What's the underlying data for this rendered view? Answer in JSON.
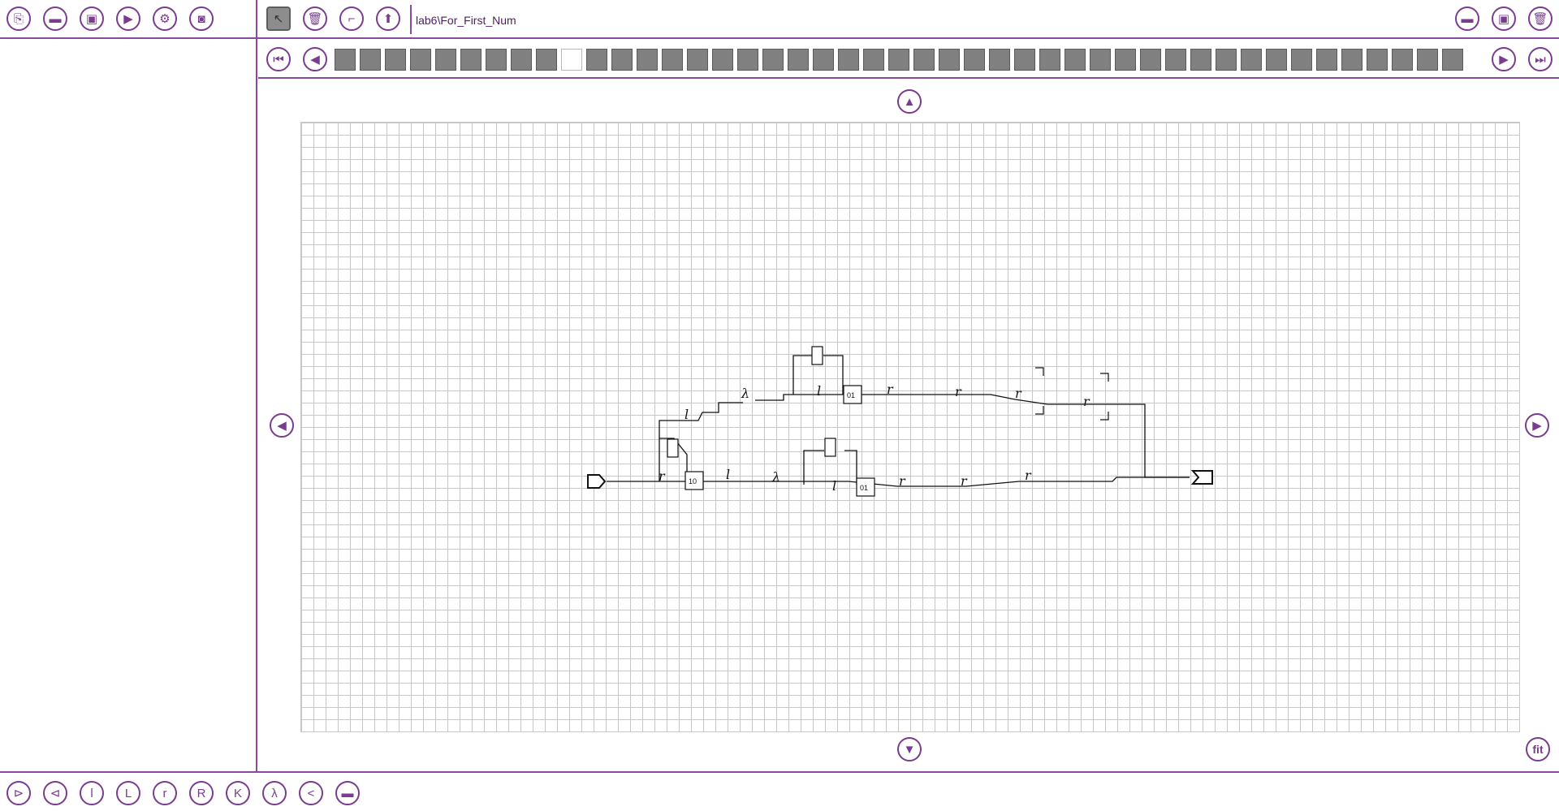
{
  "window_title": "lab6\\For_First_Num",
  "toolbar_left": [
    {
      "name": "new-file-icon",
      "glyph": "⎘"
    },
    {
      "name": "open-folder-icon",
      "glyph": "▬"
    },
    {
      "name": "save-icon",
      "glyph": "▣"
    },
    {
      "name": "run-icon",
      "glyph": "▶"
    },
    {
      "name": "settings-icon",
      "glyph": "⚙"
    },
    {
      "name": "camera-icon",
      "glyph": "◙"
    }
  ],
  "toolbar_mid": [
    {
      "name": "pointer-tool-icon",
      "glyph": "↖",
      "selected": true
    },
    {
      "name": "delete-icon",
      "glyph": "🗑"
    },
    {
      "name": "connect-tool-icon",
      "glyph": "⌐"
    },
    {
      "name": "upload-icon",
      "glyph": "⬆"
    }
  ],
  "toolbar_right": [
    {
      "name": "open-folder-right-icon",
      "glyph": "▬"
    },
    {
      "name": "save-right-icon",
      "glyph": "▣"
    },
    {
      "name": "delete-right-icon",
      "glyph": "🗑"
    }
  ],
  "frames": {
    "count": 45,
    "current_index": 9
  },
  "bottom_tools": [
    {
      "name": "input-node-icon",
      "glyph": "⊳"
    },
    {
      "name": "output-node-icon",
      "glyph": "⊲"
    },
    {
      "name": "l-small-icon",
      "glyph": "l"
    },
    {
      "name": "l-upper-icon",
      "glyph": "L"
    },
    {
      "name": "r-small-icon",
      "glyph": "r"
    },
    {
      "name": "r-upper-icon",
      "glyph": "R"
    },
    {
      "name": "k-upper-icon",
      "glyph": "K"
    },
    {
      "name": "lambda-icon",
      "glyph": "λ"
    },
    {
      "name": "share-icon",
      "glyph": "<"
    },
    {
      "name": "folder-icon",
      "glyph": "▬"
    }
  ],
  "nav": {
    "fit_label": "fit"
  },
  "diagram": {
    "lambda_label": "λ",
    "box_10": "10",
    "box_01": "01",
    "l_label": "l",
    "r_label": "r",
    "rr_label": "r"
  },
  "colors": {
    "accent": "#7a3c8e",
    "grid": "#c7c7c7",
    "frame_cell": "#808080"
  }
}
